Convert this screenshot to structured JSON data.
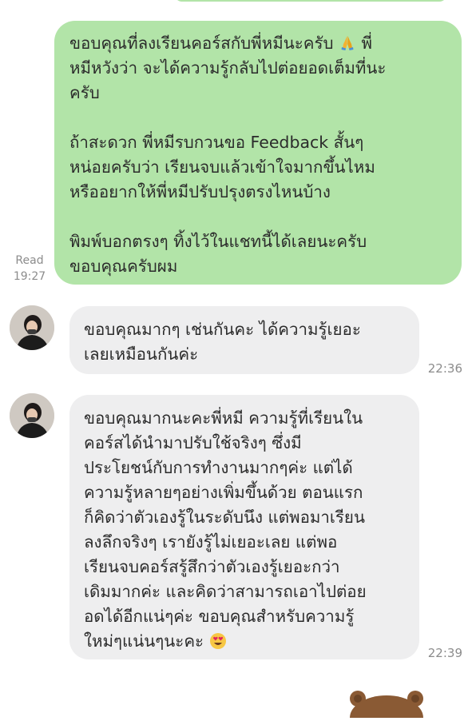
{
  "chat": {
    "messages": [
      {
        "direction": "outgoing",
        "text_1": "ขอบคุณที่ลงเรียนคอร์สกับพี่หมีนะครับ",
        "text_2": " พี่\nหมีหวังว่า จะได้ความรู้กลับไปต่อยอดเต็มที่นะ\nครับ\n\nถ้าสะดวก พี่หมีรบกวนขอ Feedback สั้นๆ\nหน่อยครับว่า เรียนจบแล้วเข้าใจมากขึ้นไหม\nหรืออยากให้พี่หมีปรับปรุงตรงไหนบ้าง\n\nพิมพ์บอกตรงๆ ทิ้งไว้ในแชทนี้ได้เลยนะครับ\nขอบคุณครับผม",
        "emoji": "folded-hands",
        "status": "Read",
        "time": "19:27"
      },
      {
        "direction": "incoming",
        "text": "ขอบคุณมากๆ เช่นกันคะ ได้ความรู้เยอะ\nเลยเหมือนกันค่ะ",
        "time": "22:36"
      },
      {
        "direction": "incoming",
        "text": "ขอบคุณมากนะคะพี่หมี ความรู้ที่เรียนใน\nคอร์สได้นำมาปรับใช้จริงๆ ซึ่งมี\nประโยชน์กับการทำงานมากๆค่ะ แต่ได้\nความรู้หลายๆอย่างเพิ่มขึ้นด้วย ตอนแรก\nก็คิดว่าตัวเองรู้ในระดับนึง แต่พอมาเรียน\nลงลึกจริงๆ เรายังรู้ไม่เยอะเลย แต่พอ\nเรียนจบคอร์สรู้สึกว่าตัวเองรู้เยอะกว่า\nเดิมมากค่ะ และคิดว่าสามารถเอาไปต่อย\nอดได้อีกแน่ๆค่ะ ขอบคุณสำหรับความรู้\nใหม่ๆแน่นๆนะคะ ",
        "emoji": "smiling-face-with-heart-eyes",
        "time": "22:39"
      }
    ],
    "colors": {
      "outgoing_bubble": "#b2e4a8",
      "incoming_bubble": "#eeeeef",
      "meta_text": "#8c8c8c",
      "message_text": "#2b2b2b"
    }
  }
}
